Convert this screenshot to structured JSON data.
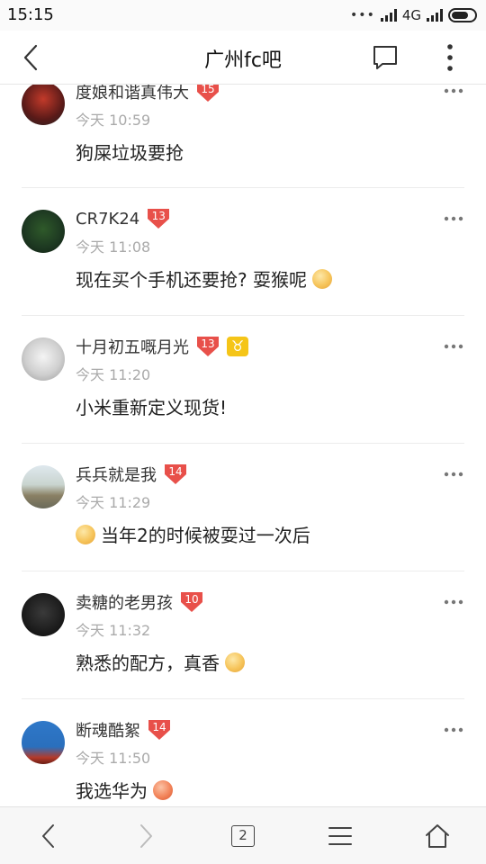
{
  "status_bar": {
    "time": "15:15",
    "dots": "•••",
    "network": "4G"
  },
  "header": {
    "title": "广州fc吧"
  },
  "posts": [
    {
      "username": "度娘和谐真伟大",
      "level": "15",
      "time": "今天 10:59",
      "text": "狗屎垃圾要抢",
      "emoji_after": ""
    },
    {
      "username": "CR7K24",
      "level": "13",
      "time": "今天 11:08",
      "text": "现在买个手机还要抢? 耍猴呢",
      "emoji_after": "smile-emoji"
    },
    {
      "username": "十月初五嘅月光",
      "level": "13",
      "zodiac": "♉",
      "time": "今天 11:20",
      "text": "小米重新定义现货!",
      "emoji_after": ""
    },
    {
      "username": "兵兵就是我",
      "level": "14",
      "time": "今天 11:29",
      "text": "当年2的时候被耍过一次后",
      "emoji_before": "smile-emoji"
    },
    {
      "username": "卖糖的老男孩",
      "level": "10",
      "time": "今天 11:32",
      "text": "熟悉的配方，真香",
      "emoji_after": "smile-emoji"
    },
    {
      "username": "断魂酷絮",
      "level": "14",
      "time": "今天 11:50",
      "text": "我选华为",
      "emoji_after": "angry-emoji"
    }
  ],
  "bottom_nav": {
    "tabs_count": "2"
  },
  "colors": {
    "level_badge": "#e8504a",
    "zodiac_badge": "#f5c518",
    "time_text": "#aaaaaa"
  }
}
